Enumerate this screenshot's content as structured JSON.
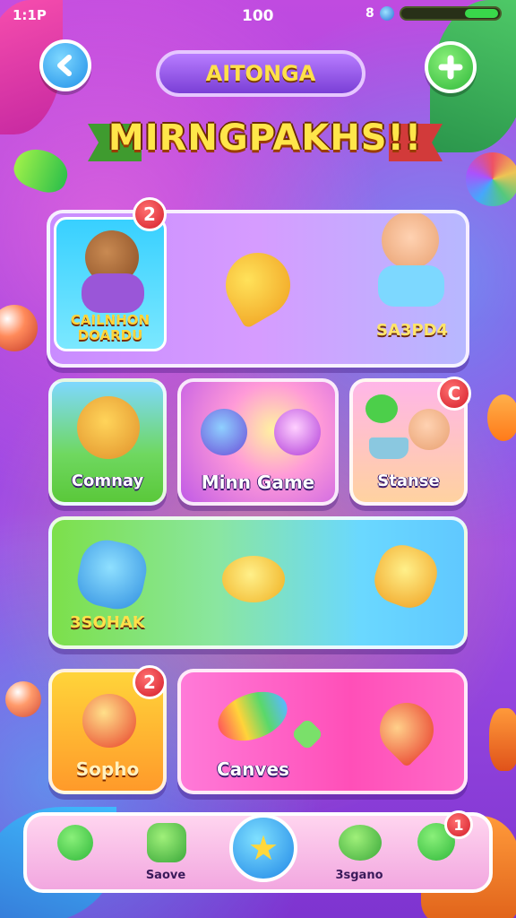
{
  "status": {
    "time": "1:1P",
    "center_value": "100",
    "right_icon": "8",
    "battery_level": 0.33
  },
  "header": {
    "back_icon": "back-arrow-icon",
    "plus_icon": "plus-icon",
    "subtitle": "AITONGA",
    "title": "MIRNGPAKHS!!"
  },
  "cards": {
    "featured": {
      "left_label": "CAILNHON DOARDU",
      "right_label": "SA3PD4",
      "badge": "2"
    },
    "community": {
      "label": "Comnay"
    },
    "mini_game": {
      "label": "Minn Game"
    },
    "stanse": {
      "label": "Stanse",
      "badge": "C"
    },
    "wide": {
      "label": "3SOHAK"
    },
    "sopho": {
      "label": "Sopho",
      "badge": "2"
    },
    "canves": {
      "label": "Canves"
    }
  },
  "bottom_nav": {
    "items": [
      {
        "label": "Saove"
      },
      {
        "label": ""
      },
      {
        "label": "3sgano"
      }
    ],
    "right_badge": "1"
  },
  "colors": {
    "accent_yellow": "#ffe14a",
    "badge_red": "#d41e2a",
    "button_blue": "#1f8fe8",
    "button_green": "#2fb83a"
  }
}
